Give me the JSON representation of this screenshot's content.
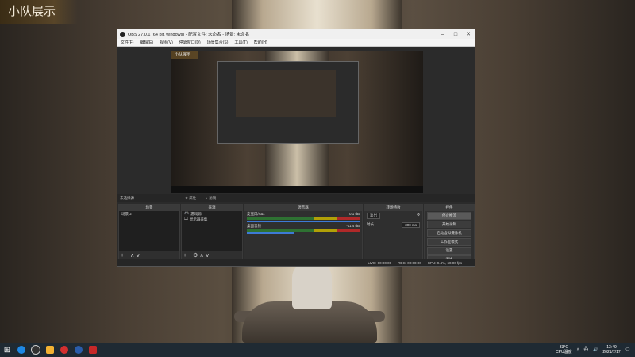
{
  "overlay": {
    "team_label": "小队展示"
  },
  "obs": {
    "title": "OBS 27.0.1 (64 bit, windows) - 配置文件: 未命名 - 场景: 未命名",
    "menu": [
      "文件(F)",
      "编辑(E)",
      "视图(V)",
      "停靠窗口(D)",
      "场景集合(S)",
      "工具(T)",
      "帮助(H)"
    ],
    "preview_label": "小队展示",
    "scene_bar": {
      "label": "未选择源",
      "properties": "属性",
      "filters": "滤镜"
    },
    "docks": {
      "scenes": {
        "title": "场景",
        "items": [
          "场景 2"
        ]
      },
      "sources": {
        "title": "来源",
        "items": [
          {
            "icon": "game-icon",
            "label": "游戏源"
          },
          {
            "icon": "monitor-icon",
            "label": "显示器采集"
          }
        ]
      },
      "mixer": {
        "title": "混音器",
        "channels": [
          {
            "name": "麦克风/Aux",
            "db": "0.1 dB"
          },
          {
            "name": "桌面音频",
            "db": "-11.4 dB"
          }
        ]
      },
      "transitions": {
        "title": "转场特效",
        "selected": "淡出",
        "duration_label": "时长",
        "duration": "300 ms"
      },
      "controls": {
        "title": "控件",
        "buttons": [
          "停止推流",
          "开始录制",
          "启动虚拟摄像机",
          "工作室模式",
          "设置",
          "退出"
        ]
      }
    },
    "status": {
      "live": "LIVE: 00:00:00",
      "rec": "REC: 00:00:00",
      "cpu": "CPU: 9.4%, 60.00 fps"
    }
  },
  "taskbar": {
    "weather": {
      "temp": "33°C",
      "text": "CPU温度"
    },
    "clock": {
      "time": "13:49",
      "date": "2021/7/17"
    }
  }
}
